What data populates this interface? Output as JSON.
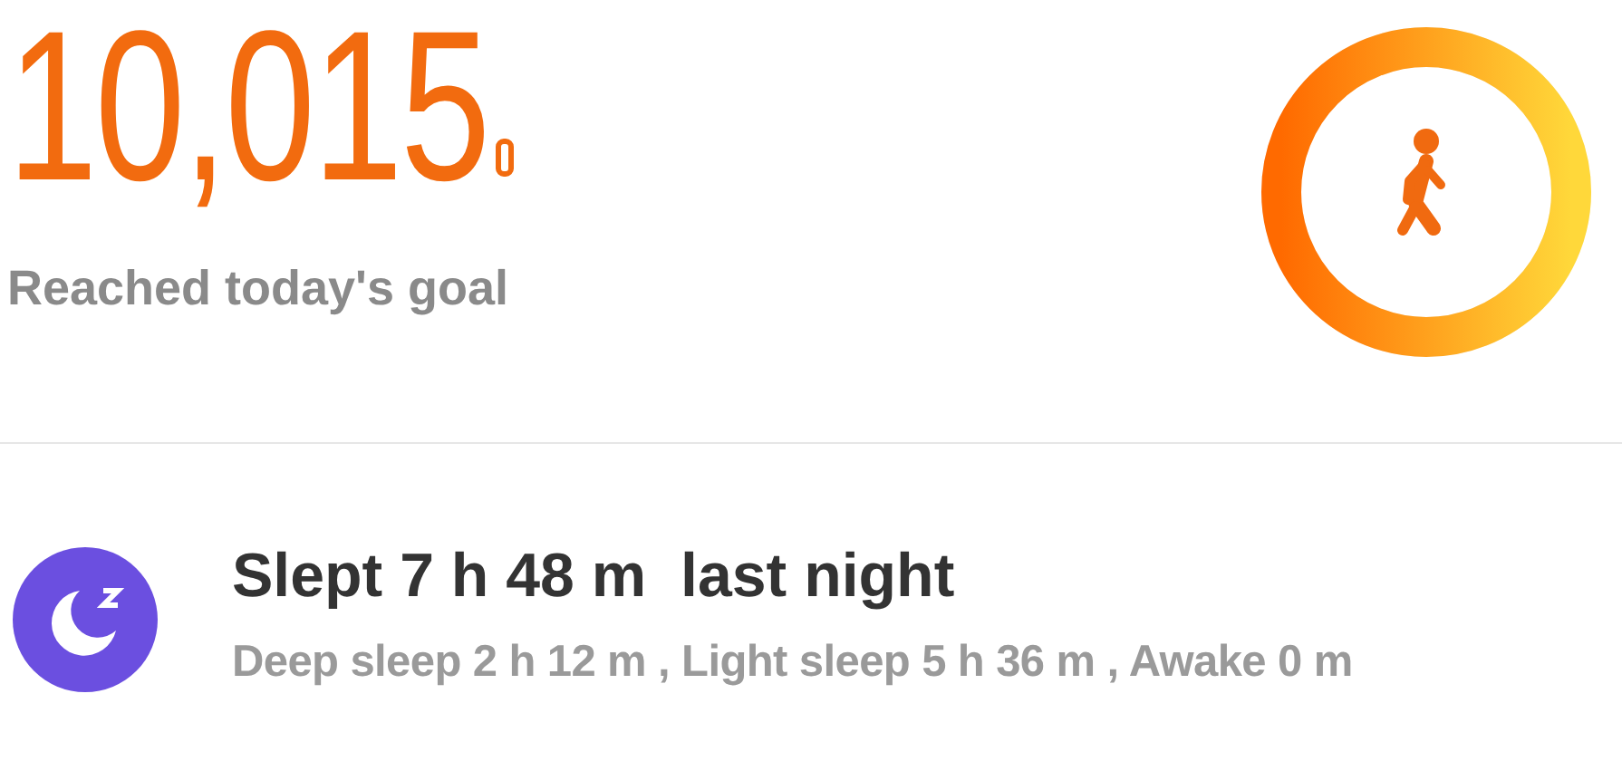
{
  "steps": {
    "count": "10,015",
    "status": "Reached today's goal",
    "level": 1
  },
  "sleep": {
    "title": "Slept 7 h 48 m  last night",
    "detail": "Deep sleep 2 h 12 m , Light sleep 5 h 36 m , Awake 0 m"
  }
}
